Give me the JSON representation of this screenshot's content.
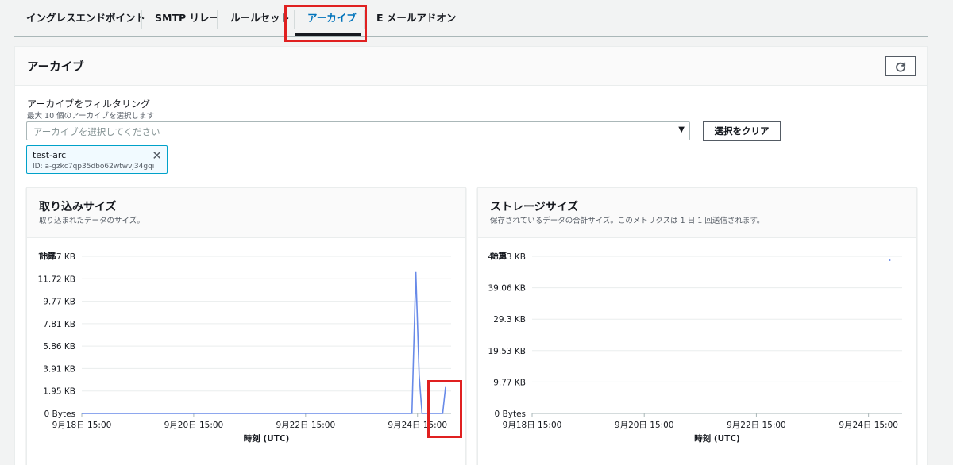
{
  "tabs": [
    {
      "label": "イングレスエンドポイント"
    },
    {
      "label": "SMTP リレー"
    },
    {
      "label": "ルールセット"
    },
    {
      "label": "アーカイブ"
    },
    {
      "label": "E メールアドオン"
    }
  ],
  "panel": {
    "title": "アーカイブ",
    "filter_label": "アーカイブをフィルタリング",
    "filter_desc": "最大 10 個のアーカイブを選択します",
    "select_placeholder": "アーカイブを選択してください",
    "clear_label": "選択をクリア",
    "token": {
      "name": "test-arc",
      "id": "ID: a-gzkc7qp35dbo62wtwvj34gqi"
    }
  },
  "charts": [
    {
      "title": "取り込みサイズ",
      "desc": "取り込まれたデータのサイズ。",
      "unit_label": "計算"
    },
    {
      "title": "ストレージサイズ",
      "desc": "保存されているデータの合計サイズ。このメトリクスは 1 日 1 回送信されます。",
      "unit_label": "計算"
    }
  ],
  "colors": {
    "accent": "#0073bb",
    "series": "#688ae8",
    "highlight": "#e02020"
  },
  "chart_data": [
    {
      "type": "line",
      "title": "取り込みサイズ",
      "ylabel": "計算",
      "xlabel": "時刻 (UTC)",
      "ylim": [
        0,
        13.67
      ],
      "yticks": [
        "0 Bytes",
        "1.95 KB",
        "3.91 KB",
        "5.86 KB",
        "7.81 KB",
        "9.77 KB",
        "11.72 KB",
        "13.67 KB"
      ],
      "xlim": [
        0,
        6.6
      ],
      "xticks": [
        "9月18日 15:00",
        "9月20日 15:00",
        "9月22日 15:00",
        "9月24日 15:00"
      ],
      "series": [
        {
          "points": [
            [
              0,
              0
            ],
            [
              5.9,
              0
            ],
            [
              5.97,
              12.3
            ],
            [
              6.03,
              3.3
            ],
            [
              6.08,
              0
            ],
            [
              6.45,
              0
            ],
            [
              6.5,
              2.3
            ]
          ]
        }
      ]
    },
    {
      "type": "line",
      "title": "ストレージサイズ",
      "ylabel": "計算",
      "xlabel": "時刻 (UTC)",
      "ylim": [
        0,
        48.83
      ],
      "yticks": [
        "0 Bytes",
        "9.77 KB",
        "19.53 KB",
        "29.3 KB",
        "39.06 KB",
        "48.83 KB"
      ],
      "xlim": [
        0,
        6.6
      ],
      "xticks": [
        "9月18日 15:00",
        "9月20日 15:00",
        "9月22日 15:00",
        "9月24日 15:00"
      ],
      "series": [
        {
          "points": [
            [
              6.38,
              47.6
            ]
          ]
        }
      ]
    }
  ]
}
